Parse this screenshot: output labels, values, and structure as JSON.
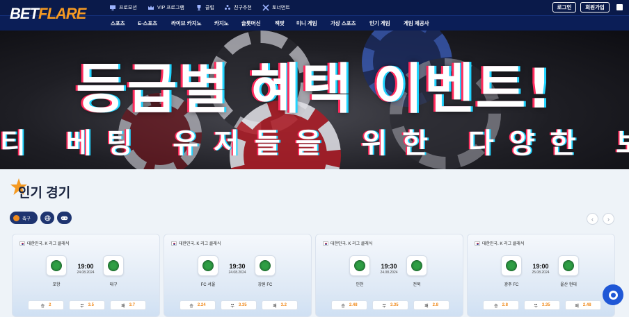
{
  "brand": {
    "bet": "BET",
    "flare": "FLARE"
  },
  "top_links": [
    {
      "label": "프로모션",
      "icon": "monitor-icon"
    },
    {
      "label": "VIP 프로그램",
      "icon": "crown-icon"
    },
    {
      "label": "클럽",
      "icon": "trophy-icon"
    },
    {
      "label": "친구추천",
      "icon": "users-icon"
    },
    {
      "label": "토너먼트",
      "icon": "crossed-swords-icon"
    }
  ],
  "auth": {
    "login": "로그인",
    "signup": "회원가입"
  },
  "nav": [
    "스포츠",
    "E-스포츠",
    "라이브 카지노",
    "카지노",
    "슬롯머신",
    "잭팟",
    "미니 게임",
    "가상 스포츠",
    "인기 게임",
    "게임 제공사"
  ],
  "banner": {
    "headline": "등급별 혜택 이벤트!",
    "subline": "티 베팅 유저들을 위한 다양한 보너"
  },
  "section": {
    "title": "인기 경기"
  },
  "filters": [
    {
      "label": "축구",
      "icon": "soccer-ball-icon"
    },
    {
      "label": "",
      "icon": "globe-icon"
    },
    {
      "label": "",
      "icon": "gamepad-icon"
    }
  ],
  "pager": {
    "prev": "‹",
    "next": "›"
  },
  "matches": [
    {
      "league": "대한민국. K 리그 클래식",
      "time": "19:00",
      "date": "24.08.2024",
      "home": "포항",
      "away": "대구",
      "odds": [
        {
          "label": "승",
          "value": "2"
        },
        {
          "label": "무",
          "value": "3.5"
        },
        {
          "label": "패",
          "value": "3.7"
        }
      ]
    },
    {
      "league": "대한민국. K 리그 클래식",
      "time": "19:30",
      "date": "24.08.2024",
      "home": "FC 서울",
      "away": "강원 FC",
      "odds": [
        {
          "label": "승",
          "value": "2.24"
        },
        {
          "label": "무",
          "value": "3.35"
        },
        {
          "label": "패",
          "value": "3.2"
        }
      ]
    },
    {
      "league": "대한민국. K 리그 클래식",
      "time": "19:30",
      "date": "24.08.2024",
      "home": "인천",
      "away": "전북",
      "odds": [
        {
          "label": "승",
          "value": "2.48"
        },
        {
          "label": "무",
          "value": "3.35"
        },
        {
          "label": "패",
          "value": "2.8"
        }
      ]
    },
    {
      "league": "대한민국. K 리그 클래식",
      "time": "19:00",
      "date": "25.08.2024",
      "home": "광주 FC",
      "away": "울산 현대",
      "odds": [
        {
          "label": "승",
          "value": "2.8"
        },
        {
          "label": "무",
          "value": "3.35"
        },
        {
          "label": "패",
          "value": "2.48"
        }
      ]
    }
  ],
  "colors": {
    "header_bg": "#0a1a4a",
    "nav_bg": "#0b1e57",
    "accent": "#f59a23",
    "odds_value": "#f08a1c",
    "chat_button": "#1f57d6"
  }
}
